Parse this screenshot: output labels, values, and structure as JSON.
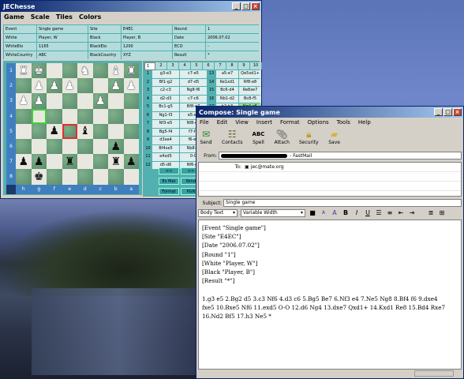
{
  "chess_window": {
    "title": "JEChesse",
    "menu": [
      "Game",
      "Scale",
      "Tiles",
      "Colors"
    ],
    "info": [
      [
        "Event",
        "Single game",
        "Site",
        "E4EC",
        "Round",
        "1"
      ],
      [
        "White",
        "Player, W",
        "Black",
        "Player, B",
        "Date",
        "2006.07.02"
      ],
      [
        "WhiteElo",
        "1165",
        "BlackElo",
        "1200",
        "ECO",
        "-"
      ],
      [
        "WhiteCountry",
        "ABC",
        "BlackCountry",
        "XYZ",
        "Result",
        "*"
      ]
    ],
    "ranks": [
      "1",
      "2",
      "3",
      "4",
      "5",
      "6",
      "7",
      "8"
    ],
    "files": [
      "h",
      "g",
      "f",
      "e",
      "d",
      "c",
      "b",
      "a"
    ],
    "board": [
      [
        "wR",
        "wK",
        "",
        "",
        "wN",
        "",
        "wB",
        "wR"
      ],
      [
        "",
        "wP",
        "wP",
        "wP",
        "",
        "",
        "wP",
        "wP"
      ],
      [
        "wP",
        "wP",
        "",
        "",
        "",
        "wP",
        "",
        ""
      ],
      [
        "",
        "",
        "",
        "",
        "",
        "",
        "",
        ""
      ],
      [
        "",
        "",
        "bP",
        "",
        "bB",
        "",
        "",
        ""
      ],
      [
        "",
        "",
        "",
        "",
        "",
        "",
        "bP",
        ""
      ],
      [
        "bP",
        "bP",
        "",
        "bR",
        "",
        "",
        "bR",
        "bP"
      ],
      [
        "",
        "bK",
        "",
        "",
        "",
        "",
        "",
        ""
      ]
    ],
    "move_tabs": [
      "1",
      "2",
      "3",
      "4",
      "5",
      "6",
      "7",
      "8",
      "9",
      "10"
    ],
    "moves": [
      [
        "1",
        "g3-e3",
        "c7-e5",
        "13",
        "a5-e7",
        "Qe5xd1+"
      ],
      [
        "2",
        "Bf1-g2",
        "d7-d5",
        "14",
        "Ke1xd1",
        "Rf8-e8"
      ],
      [
        "3",
        "c2-c3",
        "Ng8-f6",
        "15",
        "Bc6-d4",
        "Re8xe7"
      ],
      [
        "4",
        "d2-d3",
        "c7-c6",
        "16",
        "Nb1-d2",
        "Bc8-f5"
      ],
      [
        "5",
        "Bc1-g5",
        "Bf8-e7",
        "17",
        "h2-h3",
        "Ng4-e5"
      ],
      [
        "6",
        "Ng1-f3",
        "e5-e4",
        "",
        "",
        ""
      ],
      [
        "7",
        "Nf3-e5",
        "Nf8-d7",
        "",
        "",
        ""
      ],
      [
        "8",
        "Bg5-f4",
        "f7-f6",
        "",
        "",
        ""
      ],
      [
        "9",
        "d3xe4",
        "f6-e5",
        "",
        "",
        ""
      ],
      [
        "10",
        "Bf4xe5",
        "Nb8-f6",
        "",
        "",
        ""
      ],
      [
        "11",
        "e4xd5",
        "0-0",
        "",
        "",
        ""
      ],
      [
        "12",
        "d5-d6",
        "Nf6-g4",
        "",
        "",
        ""
      ]
    ],
    "buttons": [
      "<<",
      ">>",
      "Ex Mat",
      "Nrnd",
      "Format",
      "PGN"
    ]
  },
  "compose_window": {
    "title": "Compose: Single game",
    "menu": [
      "File",
      "Edit",
      "View",
      "Insert",
      "Format",
      "Options",
      "Tools",
      "Help"
    ],
    "toolbar": [
      "Send",
      "Contacts",
      "Spell",
      "Attach",
      "Security",
      "Save"
    ],
    "from_label": "From:",
    "from_value": "- FastMail",
    "to_type": "To:",
    "to_value": "jec@mate.org",
    "subject_label": "Subject:",
    "subject_value": "Single game",
    "format": {
      "style": "Body Text",
      "font": "Variable Width"
    },
    "body_lines": [
      "[Event \"Single game\"]",
      "[Site \"E4EC\"]",
      "[Date \"2006.07.02\"]",
      "[Round \"1\"]",
      "[White \"Player, W\"]",
      "[Black \"Player, B\"]",
      "[Result \"*\"]",
      "",
      "1.g3 e5 2.Bg2 d5 3.c3 Nf6 4.d3 c6 5.Bg5 Be7 6.Nf3 e4 7.Ne5 Ng8 8.Bf4 f6 9.dxe4",
      "fxe5 10.Bxe5 Nf6 11.exd5 O-O 12.d6 Ng4 13.dxe7 Qxd1+ 14.Kxd1 Re8 15.Bd4 Rxe7",
      "16.Nd2 Bf5 17.h3 Ne5 *"
    ]
  }
}
